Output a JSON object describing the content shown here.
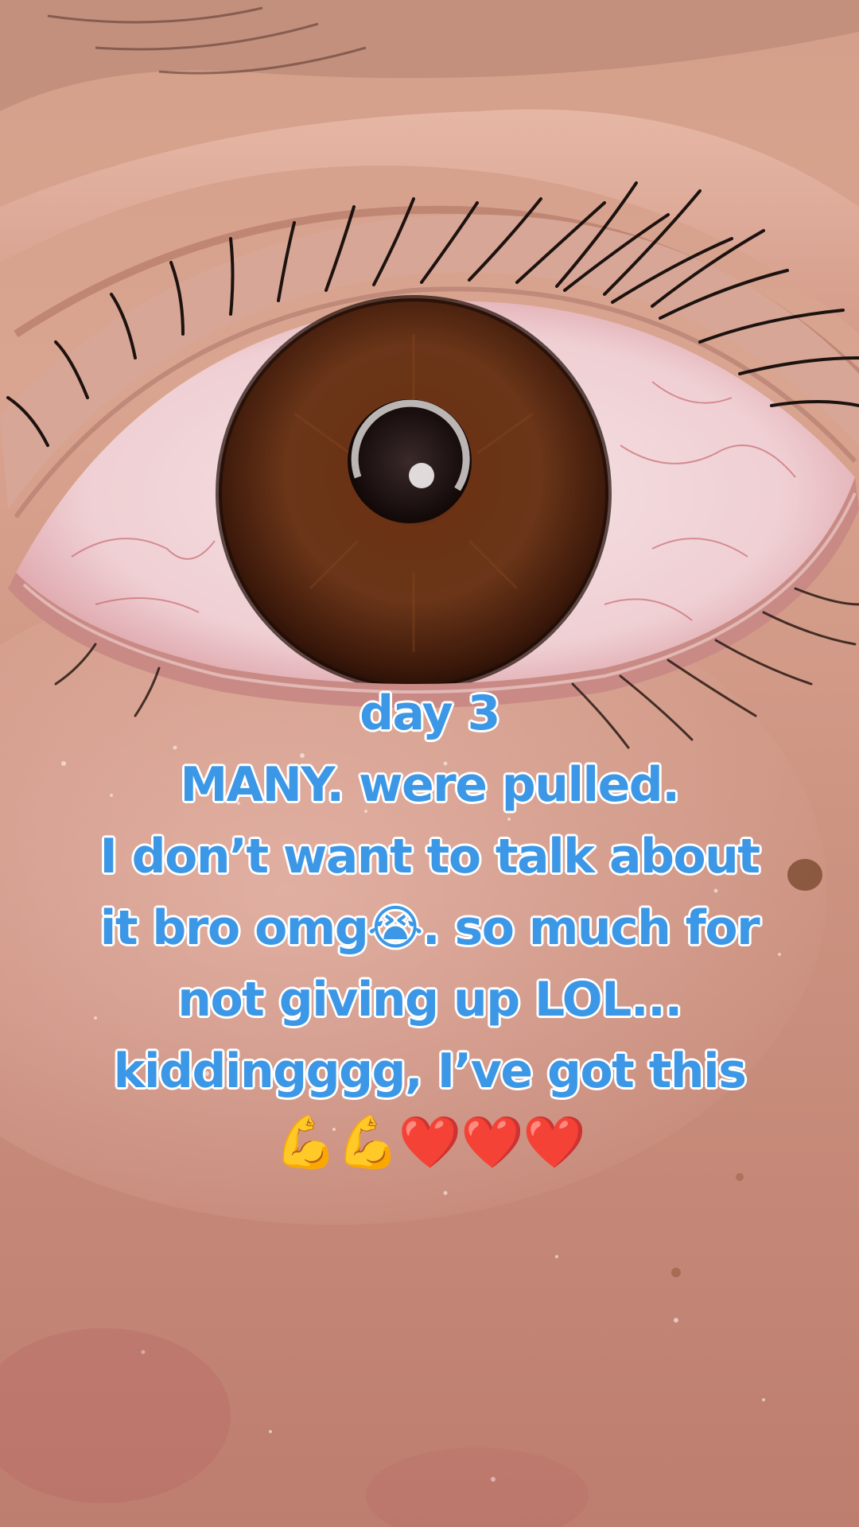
{
  "caption": {
    "lines": [
      "day 3",
      "MANY. were pulled.",
      "I don’t want to talk about",
      "it bro omg😭. so much for",
      "not giving up LOL...",
      "kiddingggg, I’ve got this",
      "💪💪❤️❤️❤️"
    ]
  },
  "colors": {
    "caption_fill": "#3c98e6",
    "caption_outline": "#ffffff",
    "skin": "#c98f80",
    "iris": "#5a2a12",
    "sclera": "#f1d9dc"
  }
}
